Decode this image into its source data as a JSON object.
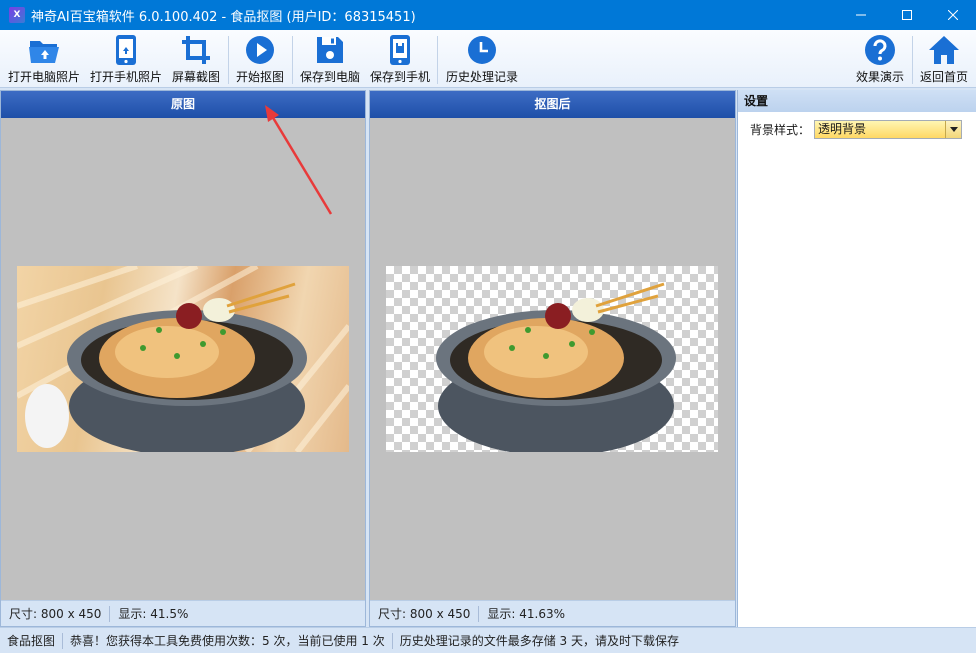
{
  "window": {
    "title": "神奇AI百宝箱软件 6.0.100.402 - 食品抠图 (用户ID：68315451)",
    "app_icon_text": "X",
    "controls": [
      "minimize-icon",
      "maximize-icon",
      "close-icon"
    ]
  },
  "toolbar": {
    "items": [
      {
        "label": "打开电脑照片",
        "icon": "folder-open-icon"
      },
      {
        "label": "打开手机照片",
        "icon": "phone-icon"
      },
      {
        "label": "屏幕截图",
        "icon": "crop-icon"
      },
      {
        "label": "开始抠图",
        "icon": "play-icon"
      },
      {
        "label": "保存到电脑",
        "icon": "save-disk-icon"
      },
      {
        "label": "保存到手机",
        "icon": "phone-save-icon"
      },
      {
        "label": "历史处理记录",
        "icon": "clock-icon"
      },
      {
        "label": "效果演示",
        "icon": "help-icon"
      },
      {
        "label": "返回首页",
        "icon": "home-icon"
      }
    ],
    "accent": "#1a6fd4"
  },
  "panels": {
    "original": {
      "header": "原图",
      "size_text": "尺寸: 800 x 450",
      "zoom_text": "显示: 41.5%"
    },
    "result": {
      "header": "抠图后",
      "size_text": "尺寸: 800 x 450",
      "zoom_text": "显示: 41.63%"
    }
  },
  "settings": {
    "title": "设置",
    "background_style_label": "背景样式：",
    "background_style_value": "透明背景"
  },
  "statusbar": {
    "mode": "食品抠图",
    "message": "恭喜！您获得本工具免费使用次数：5 次，当前已使用 1 次",
    "note": "历史处理记录的文件最多存储 3 天，请及时下载保存"
  },
  "colors": {
    "title_bar": "#0078d7",
    "panel_header": "#2a5cb5",
    "annotation_arrow": "#e83a3a"
  }
}
